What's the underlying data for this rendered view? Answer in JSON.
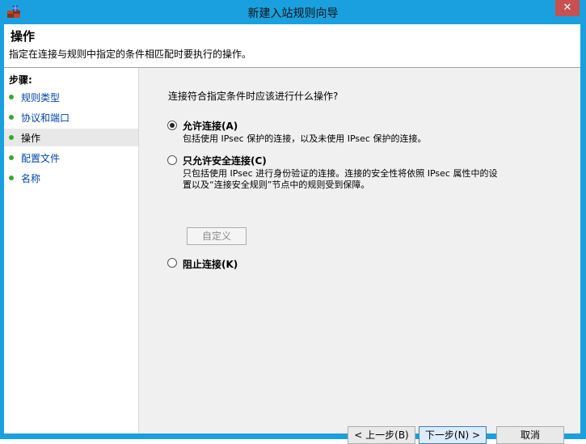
{
  "window": {
    "title": "新建入站规则向导",
    "close_glyph": "✕",
    "accent": "#1aa0df"
  },
  "header": {
    "title": "操作",
    "description": "指定在连接与规则中指定的条件相匹配时要执行的操作。"
  },
  "steps": {
    "label": "步骤:",
    "items": [
      {
        "label": "规则类型",
        "active": false
      },
      {
        "label": "协议和端口",
        "active": false
      },
      {
        "label": "操作",
        "active": true
      },
      {
        "label": "配置文件",
        "active": false
      },
      {
        "label": "名称",
        "active": false
      }
    ]
  },
  "main": {
    "question": "连接符合指定条件时应该进行什么操作?",
    "options": [
      {
        "title": "允许连接(A)",
        "desc": "包括使用 IPsec 保护的连接，以及未使用 IPsec 保护的连接。",
        "selected": true
      },
      {
        "title": "只允许安全连接(C)",
        "desc_line1": "只包括使用 IPsec 进行身份验证的连接。连接的安全性将依照 IPsec 属性中的设",
        "desc_line2": "置以及“连接安全规则”节点中的规则受到保障。",
        "selected": false
      },
      {
        "title": "阻止连接(K)",
        "selected": false
      }
    ],
    "customize_label": "自定义"
  },
  "buttons": {
    "back": "< 上一步(B)",
    "next": "下一步(N) >",
    "cancel": "取消"
  }
}
